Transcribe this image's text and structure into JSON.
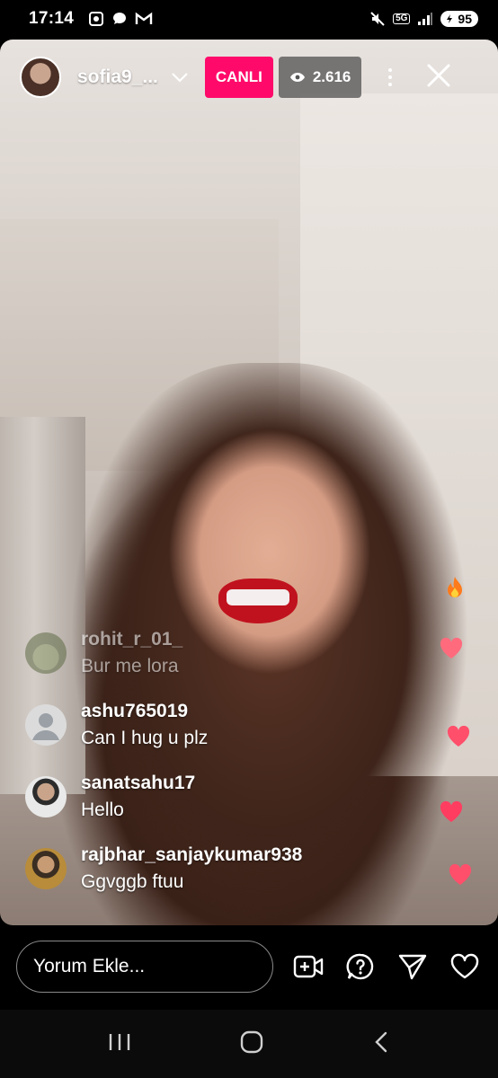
{
  "status_bar": {
    "time": "17:14",
    "network": "5G",
    "battery": "95",
    "icons": [
      "screen-record-icon",
      "chat-bubble-icon",
      "gmail-icon",
      "mute-icon",
      "wifi-icon",
      "signal-icon",
      "battery-icon"
    ]
  },
  "live": {
    "host_name": "sofia9_...",
    "live_label": "CANLI",
    "viewer_count": "2.616",
    "accent": "#ff0a6a"
  },
  "comments": [
    {
      "user": "rohit_r_01_",
      "message": "Bur me lora",
      "avatar": "landscape-avatar"
    },
    {
      "user": "ashu765019",
      "message": "Can I hug u plz",
      "avatar": "default-avatar"
    },
    {
      "user": "sanatsahu17",
      "message": "Hello",
      "avatar": "photo-avatar"
    },
    {
      "user": "rajbhar_sanjaykumar938",
      "message": "Ggvggb ftuu",
      "avatar": "photo-avatar"
    }
  ],
  "reactions": [
    "fire-icon",
    "heart-icon",
    "heart-icon",
    "heart-icon",
    "heart-icon"
  ],
  "bottom_bar": {
    "comment_placeholder": "Yorum Ekle...",
    "actions": [
      "add-video-icon",
      "question-icon",
      "share-icon",
      "heart-icon"
    ]
  },
  "nav_bar": {
    "buttons": [
      "recents-icon",
      "home-icon",
      "back-icon"
    ]
  }
}
